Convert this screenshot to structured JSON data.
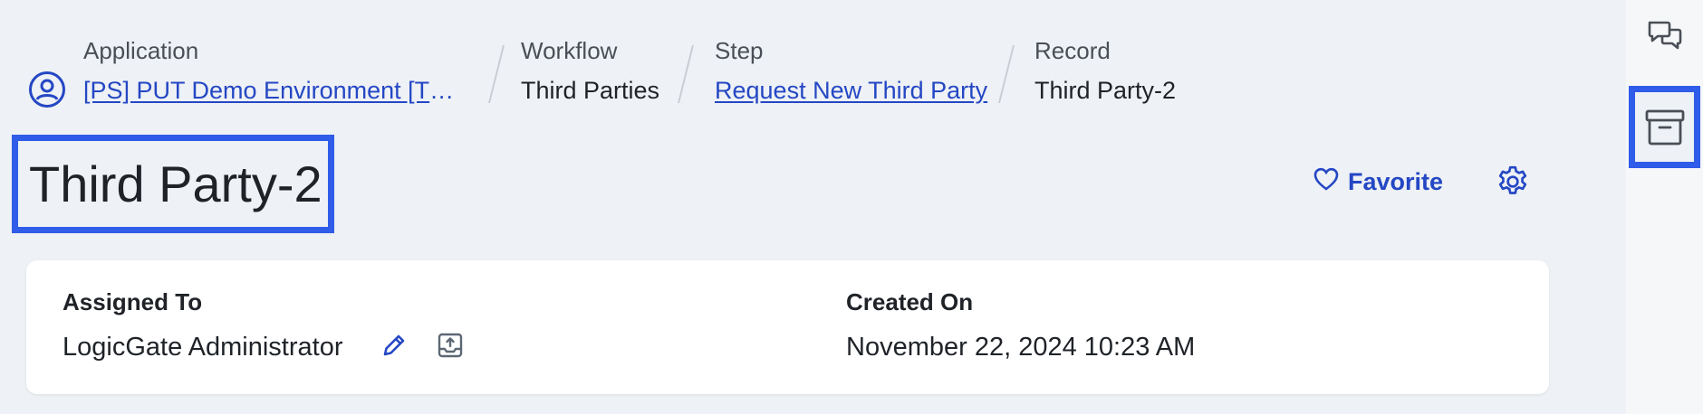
{
  "breadcrumb": {
    "application": {
      "label": "Application",
      "value": "[PS] PUT Demo Environment [TP…"
    },
    "workflow": {
      "label": "Workflow",
      "value": "Third Parties"
    },
    "step": {
      "label": "Step",
      "value": "Request New Third Party"
    },
    "record": {
      "label": "Record",
      "value": "Third Party-2"
    }
  },
  "page": {
    "title": "Third Party-2",
    "favorite_label": "Favorite"
  },
  "details": {
    "assigned_to_label": "Assigned To",
    "assigned_to_value": "LogicGate Administrator",
    "created_on_label": "Created On",
    "created_on_value": "November 22, 2024 10:23 AM"
  },
  "icons": {
    "application": "user-circle-icon",
    "favorite": "heart-icon",
    "settings": "gear-icon",
    "edit": "pencil-icon",
    "reassign": "upload-tray-icon",
    "comments": "chat-bubbles-icon",
    "archive": "archive-box-icon"
  },
  "colors": {
    "accent": "#2447c4",
    "highlight": "#2f5ce8",
    "background": "#eef1f5"
  }
}
